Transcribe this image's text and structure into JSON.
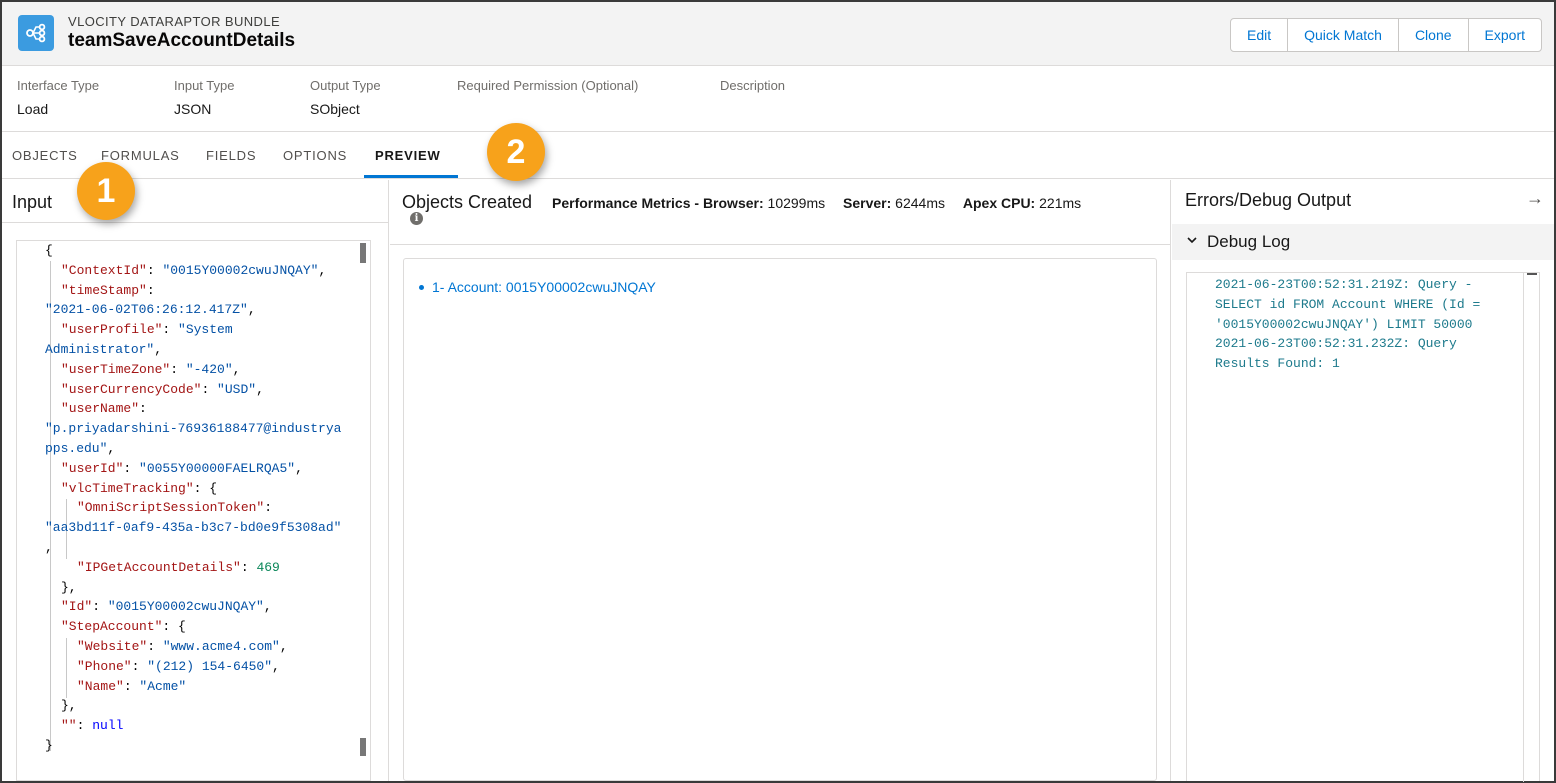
{
  "header": {
    "object_type": "VLOCITY DATARAPTOR BUNDLE",
    "record_name": "teamSaveAccountDetails",
    "icon": "dataraptor-bundle-icon",
    "buttons": [
      "Edit",
      "Quick Match",
      "Clone",
      "Export"
    ]
  },
  "fields": [
    {
      "label": "Interface Type",
      "value": "Load"
    },
    {
      "label": "Input Type",
      "value": "JSON"
    },
    {
      "label": "Output Type",
      "value": "SObject"
    },
    {
      "label": "Required Permission (Optional)",
      "value": ""
    },
    {
      "label": "Description",
      "value": ""
    }
  ],
  "tabs": [
    "OBJECTS",
    "FORMULAS",
    "FIELDS",
    "OPTIONS",
    "PREVIEW"
  ],
  "active_tab": "PREVIEW",
  "callouts": [
    "1",
    "2"
  ],
  "input_panel": {
    "title": "Input",
    "json_lines": [
      {
        "indent": 0,
        "parts": [
          [
            "p",
            "{"
          ]
        ]
      },
      {
        "indent": 1,
        "parts": [
          [
            "k",
            "\"ContextId\""
          ],
          [
            "p",
            ": "
          ],
          [
            "s",
            "\"0015Y00002cwuJNQAY\""
          ],
          [
            "p",
            ","
          ]
        ]
      },
      {
        "indent": 1,
        "parts": [
          [
            "k",
            "\"timeStamp\""
          ],
          [
            "p",
            ":"
          ]
        ]
      },
      {
        "indent": 0,
        "parts": [
          [
            "s",
            "\"2021-06-02T06:26:12.417Z\""
          ],
          [
            "p",
            ","
          ]
        ]
      },
      {
        "indent": 1,
        "parts": [
          [
            "k",
            "\"userProfile\""
          ],
          [
            "p",
            ": "
          ],
          [
            "s",
            "\"System"
          ]
        ]
      },
      {
        "indent": 0,
        "parts": [
          [
            "s",
            "Administrator\""
          ],
          [
            "p",
            ","
          ]
        ]
      },
      {
        "indent": 1,
        "parts": [
          [
            "k",
            "\"userTimeZone\""
          ],
          [
            "p",
            ": "
          ],
          [
            "s",
            "\"-420\""
          ],
          [
            "p",
            ","
          ]
        ]
      },
      {
        "indent": 1,
        "parts": [
          [
            "k",
            "\"userCurrencyCode\""
          ],
          [
            "p",
            ": "
          ],
          [
            "s",
            "\"USD\""
          ],
          [
            "p",
            ","
          ]
        ]
      },
      {
        "indent": 1,
        "parts": [
          [
            "k",
            "\"userName\""
          ],
          [
            "p",
            ":"
          ]
        ]
      },
      {
        "indent": 0,
        "parts": [
          [
            "s",
            "\"p.priyadarshini-76936188477@industrya"
          ]
        ]
      },
      {
        "indent": 0,
        "parts": [
          [
            "s",
            "pps.edu\""
          ],
          [
            "p",
            ","
          ]
        ]
      },
      {
        "indent": 1,
        "parts": [
          [
            "k",
            "\"userId\""
          ],
          [
            "p",
            ": "
          ],
          [
            "s",
            "\"0055Y00000FAELRQA5\""
          ],
          [
            "p",
            ","
          ]
        ]
      },
      {
        "indent": 1,
        "parts": [
          [
            "k",
            "\"vlcTimeTracking\""
          ],
          [
            "p",
            ": {"
          ]
        ]
      },
      {
        "indent": 2,
        "parts": [
          [
            "k",
            "\"OmniScriptSessionToken\""
          ],
          [
            "p",
            ":"
          ]
        ]
      },
      {
        "indent": 0,
        "parts": [
          [
            "s",
            "\"aa3bd11f-0af9-435a-b3c7-bd0e9f5308ad\""
          ]
        ]
      },
      {
        "indent": 0,
        "parts": [
          [
            "p",
            ","
          ]
        ]
      },
      {
        "indent": 2,
        "parts": [
          [
            "k",
            "\"IPGetAccountDetails\""
          ],
          [
            "p",
            ": "
          ],
          [
            "n",
            "469"
          ]
        ]
      },
      {
        "indent": 1,
        "parts": [
          [
            "p",
            "},"
          ]
        ]
      },
      {
        "indent": 1,
        "parts": [
          [
            "k",
            "\"Id\""
          ],
          [
            "p",
            ": "
          ],
          [
            "s",
            "\"0015Y00002cwuJNQAY\""
          ],
          [
            "p",
            ","
          ]
        ]
      },
      {
        "indent": 1,
        "parts": [
          [
            "k",
            "\"StepAccount\""
          ],
          [
            "p",
            ": {"
          ]
        ]
      },
      {
        "indent": 2,
        "parts": [
          [
            "k",
            "\"Website\""
          ],
          [
            "p",
            ": "
          ],
          [
            "s",
            "\"www.acme4.com\""
          ],
          [
            "p",
            ","
          ]
        ]
      },
      {
        "indent": 2,
        "parts": [
          [
            "k",
            "\"Phone\""
          ],
          [
            "p",
            ": "
          ],
          [
            "s",
            "\"(212) 154-6450\""
          ],
          [
            "p",
            ","
          ]
        ]
      },
      {
        "indent": 2,
        "parts": [
          [
            "k",
            "\"Name\""
          ],
          [
            "p",
            ": "
          ],
          [
            "s",
            "\"Acme\""
          ]
        ]
      },
      {
        "indent": 1,
        "parts": [
          [
            "p",
            "},"
          ]
        ]
      },
      {
        "indent": 1,
        "parts": [
          [
            "k",
            "\"\""
          ],
          [
            "p",
            ": "
          ],
          [
            "b",
            "null"
          ]
        ]
      },
      {
        "indent": 0,
        "parts": [
          [
            "p",
            "}"
          ]
        ]
      }
    ]
  },
  "objects_panel": {
    "title": "Objects Created",
    "metrics": [
      {
        "label": "Performance Metrics - Browser:",
        "value": "10299ms"
      },
      {
        "label": "Server:",
        "value": "6244ms"
      },
      {
        "label": "Apex CPU:",
        "value": "221ms"
      }
    ],
    "items": [
      "1- Account: 0015Y00002cwuJNQAY"
    ]
  },
  "debug_panel": {
    "title": "Errors/Debug Output",
    "section_title": "Debug Log",
    "log": "2021-06-23T00:52:31.219Z: Query -\nSELECT id FROM Account WHERE (Id =\n'0015Y00002cwuJNQAY') LIMIT 50000\n2021-06-23T00:52:31.232Z: Query\nResults Found: 1"
  }
}
